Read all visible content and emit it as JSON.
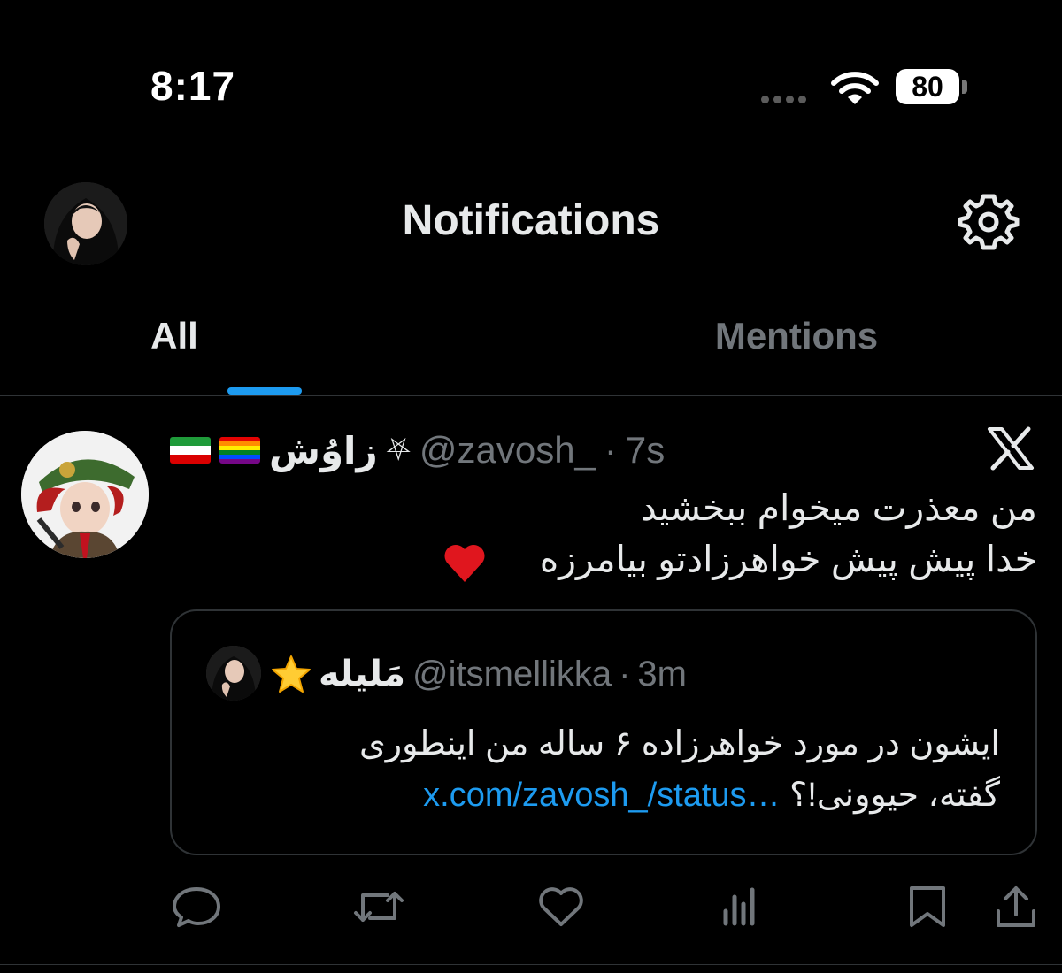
{
  "status_bar": {
    "time": "8:17",
    "battery": "80"
  },
  "header": {
    "title": "Notifications"
  },
  "tabs": [
    {
      "label": "All",
      "active": true
    },
    {
      "label": "Mentions",
      "active": false
    }
  ],
  "post": {
    "display_name": "زاوُش",
    "handle": "@zavosh_",
    "dot": "·",
    "time": "7s",
    "text_line1": "من معذرت میخوام ببخشید",
    "text_line2": "خدا پیش پیش خواهرزادتو بیامرزه",
    "icons": [
      "iran-flag-icon",
      "rainbow-flag-icon",
      "pentagram-icon",
      "red-heart-emoji",
      "x-logo-icon"
    ]
  },
  "quote": {
    "display_name": "مَلیله",
    "handle": "@itsmellikka",
    "dot": "·",
    "time": "3m",
    "text_line1": "ایشون در مورد خواهرزاده ۶ ساله من اینطوری",
    "text_line2": "گفته، حیوونی!؟",
    "link": "x.com/zavosh_/status…",
    "icons": [
      "star-emoji"
    ]
  },
  "actions": [
    "reply-icon",
    "retweet-icon",
    "like-icon",
    "views-icon",
    "bookmark-icon",
    "share-icon"
  ],
  "colors": {
    "background": "#000000",
    "text": "#e7e9ea",
    "secondary": "#71767b",
    "accent": "#1d9bf0",
    "border": "#2f3336"
  }
}
